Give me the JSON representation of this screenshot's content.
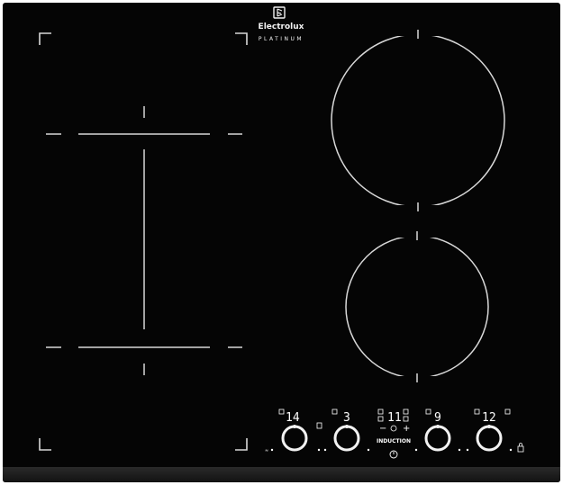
{
  "brand": {
    "name": "Electrolux",
    "line": "PLATINUM",
    "logo_icon": "electrolux-logo-icon"
  },
  "colors": {
    "glass": "#050505",
    "markings": "#d8d8d8",
    "frame_edge": "#1c1c1c"
  },
  "zones": {
    "flexi": {
      "name": "flexi-bridge-zone"
    },
    "top_right": {
      "name": "large-round-zone"
    },
    "bottom_right": {
      "name": "medium-round-zone"
    }
  },
  "controls": {
    "zone1_level": "14",
    "zone2_level": "3",
    "timer_display": "11",
    "timer_minus": "−",
    "timer_plus": "+",
    "zone3_level": "9",
    "zone4_level": "12",
    "induction_label": "INDUCTION",
    "power_icon": "power-icon",
    "slider_icon": "slider-dial-icon",
    "timer_icon": "timer-icon",
    "lock_icon": "lock-icon"
  }
}
